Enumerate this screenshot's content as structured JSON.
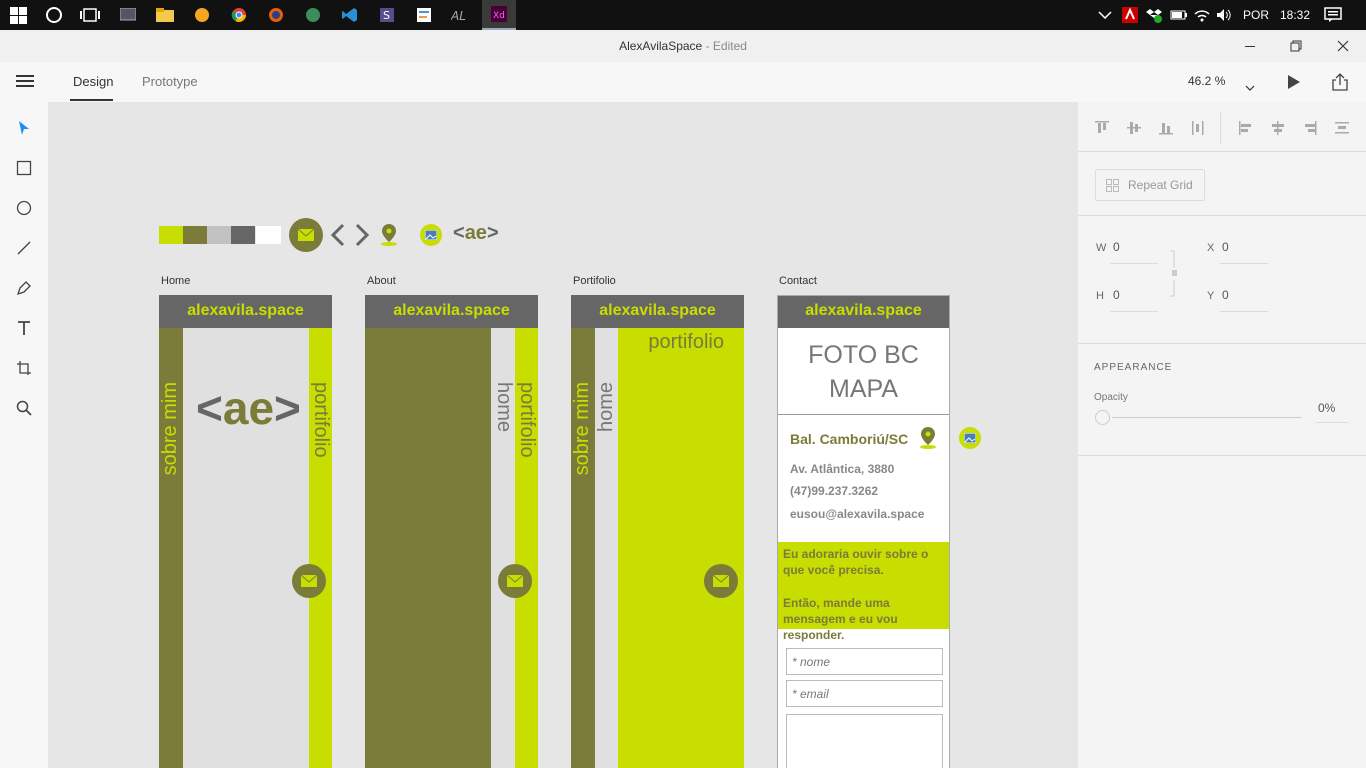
{
  "taskbar": {
    "lang": "POR",
    "time": "18:32"
  },
  "window": {
    "title": "AlexAvilaSpace",
    "status": "- Edited"
  },
  "tabs": [
    {
      "label": "Design"
    },
    {
      "label": "Prototype"
    }
  ],
  "zoom": "46.2 %",
  "palette": [
    "#c8dd00",
    "#7b7b3a",
    "#c2c2c2",
    "#666666",
    "#ffffff"
  ],
  "logo_text": "ae",
  "artboards": {
    "home": {
      "label": "Home",
      "header": "alexavila.space",
      "left_text": "sobre mim",
      "right_text": "portifolio"
    },
    "about": {
      "label": "About",
      "header": "alexavila.space",
      "text1": "home",
      "text2": "portifolio"
    },
    "portfolio": {
      "label": "Portifolio",
      "header": "alexavila.space",
      "text1": "sobre mim",
      "text2": "home",
      "title": "portifolio"
    },
    "contact": {
      "label": "Contact",
      "header": "alexavila.space",
      "photo": "FOTO BC MAPA",
      "city": "Bal. Camboriú/SC",
      "address": "Av. Atlântica, 3880",
      "phone": "(47)99.237.3262",
      "email": "eusou@alexavila.space",
      "msg1": "Eu adoraria ouvir sobre o que você precisa.",
      "msg2": "Então, mande uma mensagem e eu vou responder.",
      "name_placeholder": "* nome",
      "email_placeholder": "* email"
    }
  },
  "panel": {
    "repeat_grid": "Repeat Grid",
    "w_label": "W",
    "w": "0",
    "x_label": "X",
    "x": "0",
    "h_label": "H",
    "h": "0",
    "y_label": "Y",
    "y": "0",
    "appearance": "APPEARANCE",
    "opacity_label": "Opacity",
    "opacity": "0%"
  },
  "colors": {
    "accent": "#c8dd00",
    "olive": "#7b7b3a",
    "gray": "#666666",
    "tab_active": "#333333",
    "selection": "#1f8ef1"
  }
}
